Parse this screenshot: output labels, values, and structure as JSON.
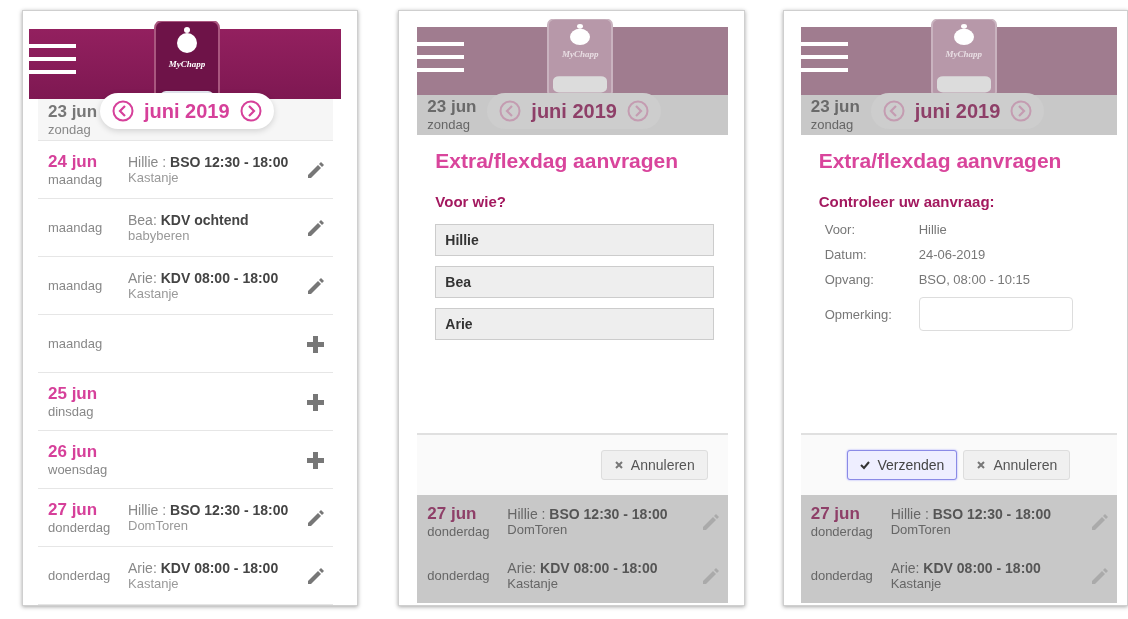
{
  "screens": [
    {
      "logo": "MyChapp",
      "month": "juni 2019",
      "first_day": {
        "date": "23 jun",
        "weekday": "zondag",
        "past": true
      },
      "rows": [
        {
          "date": "24 jun",
          "weekday": "maandag",
          "booking": "Hillie : **BSO 12:30 - 18:00**",
          "location": "Kastanje",
          "kind": "edit"
        },
        {
          "weekday": "maandag",
          "booking": "Bea: **KDV ochtend**",
          "location": "babyberen",
          "kind": "edit"
        },
        {
          "weekday": "maandag",
          "booking": "Arie: **KDV 08:00 - 18:00**",
          "location": "Kastanje",
          "kind": "edit"
        },
        {
          "weekday": "maandag",
          "kind": "add"
        },
        {
          "date": "25 jun",
          "weekday": "dinsdag",
          "kind": "add"
        },
        {
          "date": "26 jun",
          "weekday": "woensdag",
          "kind": "add"
        },
        {
          "date": "27 jun",
          "weekday": "donderdag",
          "booking": "Hillie : **BSO 12:30 - 18:00**",
          "location": "DomToren",
          "kind": "edit"
        },
        {
          "weekday": "donderdag",
          "booking": "Arie: **KDV 08:00 - 18:00**",
          "location": "Kastanje",
          "kind": "edit"
        }
      ]
    },
    {
      "logo": "MyChapp",
      "month": "juni 2019",
      "first_day": {
        "date": "23 jun",
        "weekday": "zondag",
        "past": true
      },
      "dialog": {
        "kind": "choose",
        "title": "Extra/flexdag aanvragen",
        "subtitle": "Voor wie?",
        "options": [
          "Hillie",
          "Bea",
          "Arie"
        ],
        "buttons": [
          {
            "kind": "cancel",
            "label": "Annuleren",
            "focused": false
          }
        ]
      },
      "rows": [
        {
          "date": "27 jun",
          "weekday": "donderdag",
          "booking": "Hillie : **BSO 12:30 - 18:00**",
          "location": "DomToren",
          "kind": "edit"
        },
        {
          "weekday": "donderdag",
          "booking": "Arie: **KDV 08:00 - 18:00**",
          "location": "Kastanje",
          "kind": "edit"
        }
      ]
    },
    {
      "logo": "MyChapp",
      "month": "juni 2019",
      "first_day": {
        "date": "23 jun",
        "weekday": "zondag",
        "past": true
      },
      "dialog": {
        "kind": "review",
        "title": "Extra/flexdag aanvragen",
        "subtitle": "Controleer uw aanvraag:",
        "details": [
          {
            "label": "Voor:",
            "value": "Hillie"
          },
          {
            "label": "Datum:",
            "value": "24-06-2019"
          },
          {
            "label": "Opvang:",
            "value": "BSO, 08:00 - 10:15"
          }
        ],
        "remark": {
          "label": "Opmerking:"
        },
        "buttons": [
          {
            "kind": "confirm",
            "label": "Verzenden",
            "focused": true
          },
          {
            "kind": "cancel",
            "label": "Annuleren",
            "focused": false
          }
        ]
      },
      "rows": [
        {
          "date": "27 jun",
          "weekday": "donderdag",
          "booking": "Hillie : **BSO 12:30 - 18:00**",
          "location": "DomToren",
          "kind": "edit"
        },
        {
          "weekday": "donderdag",
          "booking": "Arie: **KDV 08:00 - 18:00**",
          "location": "Kastanje",
          "kind": "edit"
        }
      ]
    }
  ]
}
